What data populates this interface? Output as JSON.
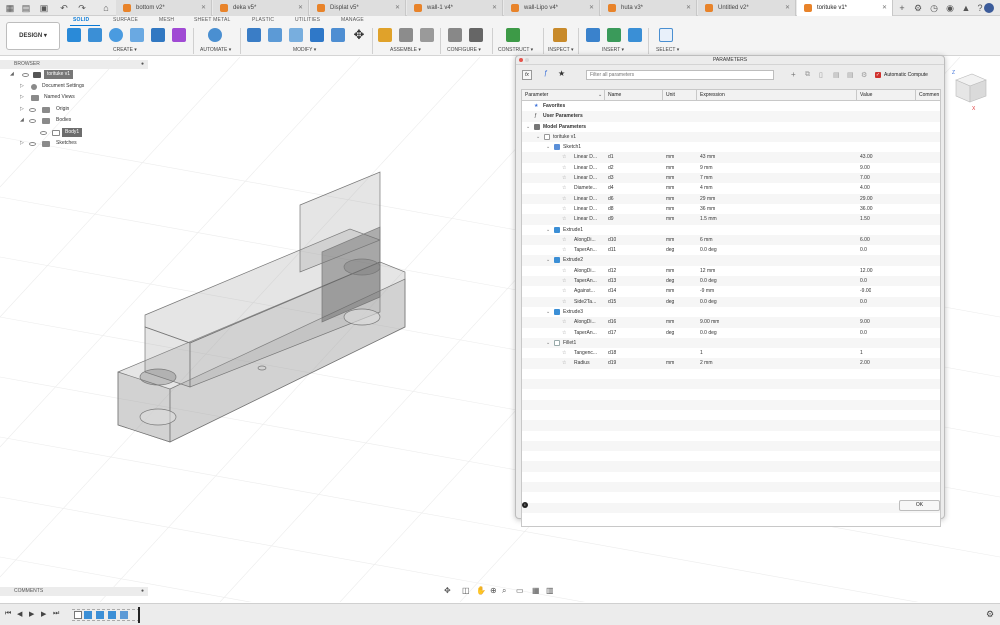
{
  "tabs": [
    {
      "label": "bottom v2*",
      "active": false
    },
    {
      "label": "deka v5*",
      "active": false
    },
    {
      "label": "Displat v5*",
      "active": false
    },
    {
      "label": "wall-1 v4*",
      "active": false
    },
    {
      "label": "wall-Lipo v4*",
      "active": false
    },
    {
      "label": "huta v3*",
      "active": false
    },
    {
      "label": "Untitled v2*",
      "active": false
    },
    {
      "label": "torituke v1*",
      "active": true
    }
  ],
  "ribbon": {
    "design": "DESIGN ▾",
    "tabs": [
      "SOLID",
      "SURFACE",
      "MESH",
      "SHEET METAL",
      "PLASTIC",
      "UTILITIES",
      "MANAGE"
    ],
    "groups": [
      "CREATE ▾",
      "AUTOMATE ▾",
      "MODIFY ▾",
      "ASSEMBLE ▾",
      "CONFIGURE ▾",
      "CONSTRUCT ▾",
      "INSPECT ▾",
      "INSERT ▾",
      "SELECT ▾"
    ]
  },
  "browser": {
    "header": "BROWSER",
    "root": "torituke v1",
    "items": [
      "Document Settings",
      "Named Views",
      "Origin",
      "Bodies",
      "Body1",
      "Sketches"
    ]
  },
  "comments": "COMMENTS",
  "params": {
    "title": "PARAMETERS",
    "filter_placeholder": "Filter all parameters",
    "auto_compute": "Automatic Compute",
    "columns": [
      "Parameter",
      "Name",
      "Unit",
      "Expression",
      "Value",
      "Commen"
    ],
    "ok": "OK",
    "rows": [
      {
        "type": "group",
        "indent": 0,
        "label": "Favorites",
        "icon": "star"
      },
      {
        "type": "group",
        "indent": 0,
        "label": "User Parameters",
        "icon": "fx"
      },
      {
        "type": "group",
        "indent": 0,
        "label": "Model Parameters",
        "icon": "box"
      },
      {
        "type": "group",
        "indent": 1,
        "label": "torituke v1",
        "icon": "doc"
      },
      {
        "type": "group",
        "indent": 2,
        "label": "Sketch1",
        "icon": "sketch"
      },
      {
        "type": "param",
        "p": "Linear D...",
        "n": "d1",
        "u": "mm",
        "e": "43 mm",
        "v": "43.00"
      },
      {
        "type": "param",
        "p": "Linear D...",
        "n": "d2",
        "u": "mm",
        "e": "9 mm",
        "v": "9.00"
      },
      {
        "type": "param",
        "p": "Linear D...",
        "n": "d3",
        "u": "mm",
        "e": "7 mm",
        "v": "7.00"
      },
      {
        "type": "param",
        "p": "Diamete...",
        "n": "d4",
        "u": "mm",
        "e": "4 mm",
        "v": "4.00"
      },
      {
        "type": "param",
        "p": "Linear D...",
        "n": "d6",
        "u": "mm",
        "e": "29 mm",
        "v": "29.00"
      },
      {
        "type": "param",
        "p": "Linear D...",
        "n": "d8",
        "u": "mm",
        "e": "36 mm",
        "v": "36.00"
      },
      {
        "type": "param",
        "p": "Linear D...",
        "n": "d9",
        "u": "mm",
        "e": "1.5 mm",
        "v": "1.50"
      },
      {
        "type": "group",
        "indent": 2,
        "label": "Extrude1",
        "icon": "extrude"
      },
      {
        "type": "param",
        "p": "AlongDi...",
        "n": "d10",
        "u": "mm",
        "e": "6 mm",
        "v": "6.00"
      },
      {
        "type": "param",
        "p": "TaperAn...",
        "n": "d11",
        "u": "deg",
        "e": "0.0 deg",
        "v": "0.0"
      },
      {
        "type": "group",
        "indent": 2,
        "label": "Extrude2",
        "icon": "extrude"
      },
      {
        "type": "param",
        "p": "AlongDi...",
        "n": "d12",
        "u": "mm",
        "e": "12 mm",
        "v": "12.00"
      },
      {
        "type": "param",
        "p": "TaperAn...",
        "n": "d13",
        "u": "deg",
        "e": "0.0 deg",
        "v": "0.0"
      },
      {
        "type": "param",
        "p": "Against...",
        "n": "d14",
        "u": "mm",
        "e": "-9 mm",
        "v": "-9.00"
      },
      {
        "type": "param",
        "p": "Side2Ta...",
        "n": "d15",
        "u": "deg",
        "e": "0.0 deg",
        "v": "0.0"
      },
      {
        "type": "group",
        "indent": 2,
        "label": "Extrude3",
        "icon": "extrude"
      },
      {
        "type": "param",
        "p": "AlongDi...",
        "n": "d16",
        "u": "mm",
        "e": "9.00 mm",
        "v": "9.00"
      },
      {
        "type": "param",
        "p": "TaperAn...",
        "n": "d17",
        "u": "deg",
        "e": "0.0 deg",
        "v": "0.0"
      },
      {
        "type": "group",
        "indent": 2,
        "label": "Fillet1",
        "icon": "fillet"
      },
      {
        "type": "param",
        "p": "Tangenc...",
        "n": "d18",
        "u": "",
        "e": "1",
        "v": "1"
      },
      {
        "type": "param",
        "p": "Radius",
        "n": "d19",
        "u": "mm",
        "e": "2 mm",
        "v": "2.00"
      }
    ]
  }
}
